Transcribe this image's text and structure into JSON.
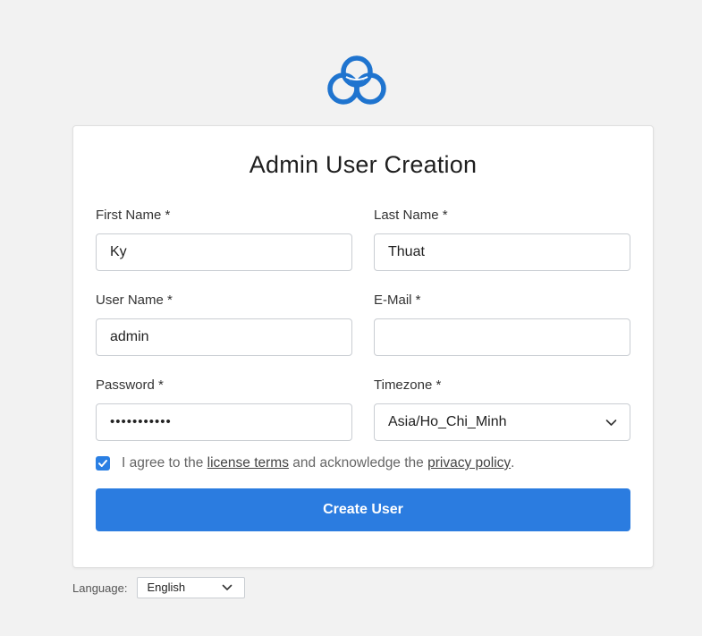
{
  "page": {
    "title": "Admin User Creation",
    "logo_icon": "cloud-logo-icon",
    "accent_color": "#2b7ce0"
  },
  "form": {
    "first_name": {
      "label": "First Name *",
      "value": "Ky"
    },
    "last_name": {
      "label": "Last Name *",
      "value": "Thuat"
    },
    "user_name": {
      "label": "User Name *",
      "value": "admin"
    },
    "email": {
      "label": "E-Mail *",
      "value": ""
    },
    "password": {
      "label": "Password *",
      "value": "•••••••••••"
    },
    "timezone": {
      "label": "Timezone *",
      "value": "Asia/Ho_Chi_Minh"
    },
    "agree": {
      "checked": true,
      "prefix": "I agree to the",
      "license_link": "license terms",
      "middle": "and acknowledge the",
      "privacy_link": "privacy policy",
      "suffix": "."
    },
    "submit_label": "Create User"
  },
  "footer": {
    "language_label": "Language:",
    "language_value": "English"
  }
}
